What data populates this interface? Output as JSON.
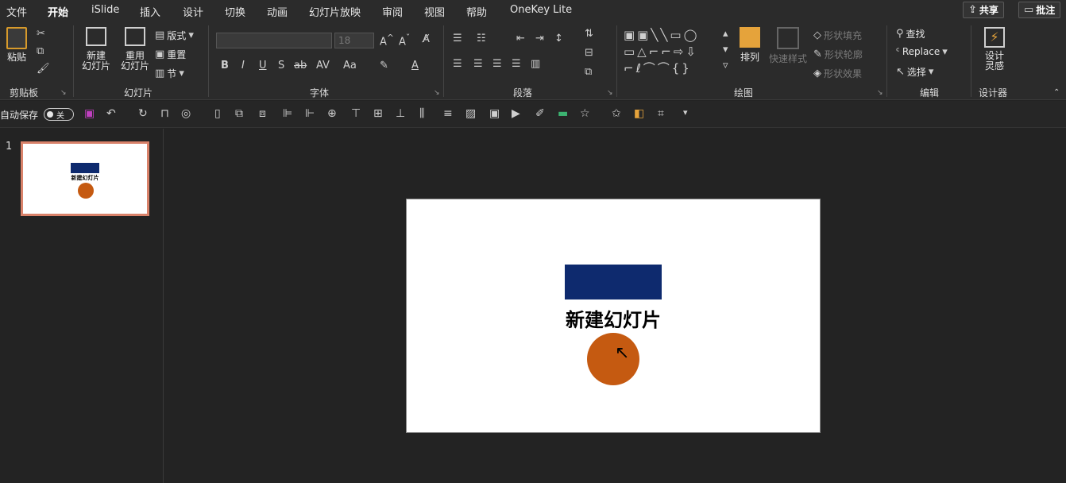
{
  "tabs": [
    "文件",
    "开始",
    "iSlide",
    "插入",
    "设计",
    "切换",
    "动画",
    "幻灯片放映",
    "审阅",
    "视图",
    "帮助",
    "OneKey Lite"
  ],
  "active_tab": "开始",
  "top_buttons": {
    "share": "共享",
    "comment": "批注"
  },
  "ribbon": {
    "clipboard": {
      "paste": "粘贴",
      "label": "剪贴板"
    },
    "slides": {
      "new_slide_line1": "新建",
      "new_slide_line2": "幻灯片",
      "reuse_line1": "重用",
      "reuse_line2": "幻灯片",
      "layout": "版式",
      "reset": "重置",
      "section": "节",
      "label": "幻灯片"
    },
    "font": {
      "font_size": "18",
      "label": "字体"
    },
    "paragraph": {
      "label": "段落"
    },
    "drawing": {
      "arrange": "排列",
      "quick_styles": "快速样式",
      "shape_fill": "形状填充",
      "shape_outline": "形状轮廓",
      "shape_effects": "形状效果",
      "label": "绘图"
    },
    "editing": {
      "find": "查找",
      "replace": "Replace",
      "select": "选择",
      "label": "编辑"
    },
    "designer": {
      "line1": "设计",
      "line2": "灵感",
      "label": "设计器"
    }
  },
  "qat": {
    "autosave": "自动保存",
    "toggle_state": "关"
  },
  "thumbnail": {
    "number": "1",
    "title": "新建幻灯片"
  },
  "slide": {
    "title": "新建幻灯片"
  },
  "colors": {
    "accent_rect": "#0e2a6e",
    "circle": "#c55a11",
    "thumb_border": "#d9826a"
  }
}
